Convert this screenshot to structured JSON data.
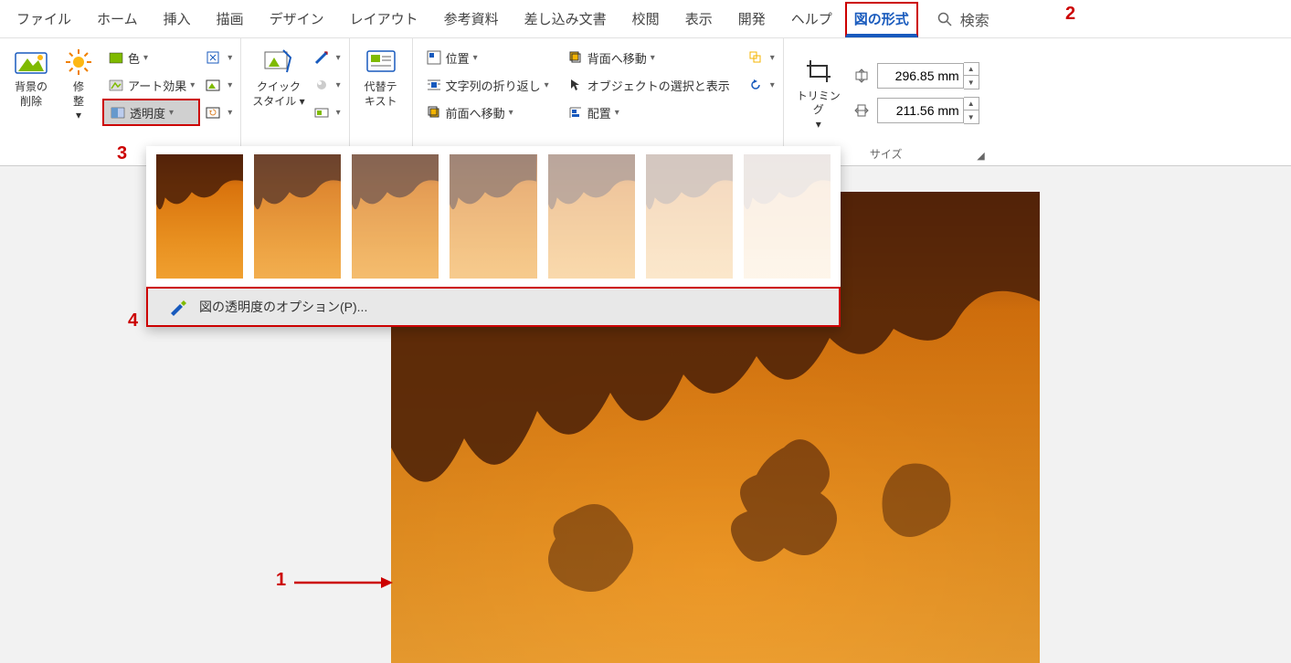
{
  "tabs": {
    "file": "ファイル",
    "home": "ホーム",
    "insert": "挿入",
    "draw": "描画",
    "design": "デザイン",
    "layout": "レイアウト",
    "references": "参考資料",
    "mailings": "差し込み文書",
    "review": "校閲",
    "view": "表示",
    "developer": "開発",
    "help": "ヘルプ",
    "picture_format": "図の形式",
    "search_label": "検索"
  },
  "ribbon": {
    "remove_bg_l1": "背景の",
    "remove_bg_l2": "削除",
    "corrections_l1": "修",
    "corrections_l2": "整",
    "color": "色",
    "artistic_effects": "アート効果",
    "transparency": "透明度",
    "quick_style_l1": "クイック",
    "quick_style_l2": "スタイル",
    "alt_text_l1": "代替テ",
    "alt_text_l2": "キスト",
    "position": "位置",
    "wrap_text": "文字列の折り返し",
    "bring_forward": "前面へ移動",
    "send_backward": "背面へ移動",
    "selection_pane": "オブジェクトの選択と表示",
    "align": "配置",
    "crop_l1": "トリミン",
    "crop_l2": "グ",
    "height_value": "296.85 mm",
    "width_value": "211.56 mm",
    "size_group": "サイズ"
  },
  "dropdown": {
    "options_label": "図の透明度のオプション(P)..."
  },
  "annotations": {
    "n1": "1",
    "n2": "2",
    "n3": "3",
    "n4": "4"
  }
}
